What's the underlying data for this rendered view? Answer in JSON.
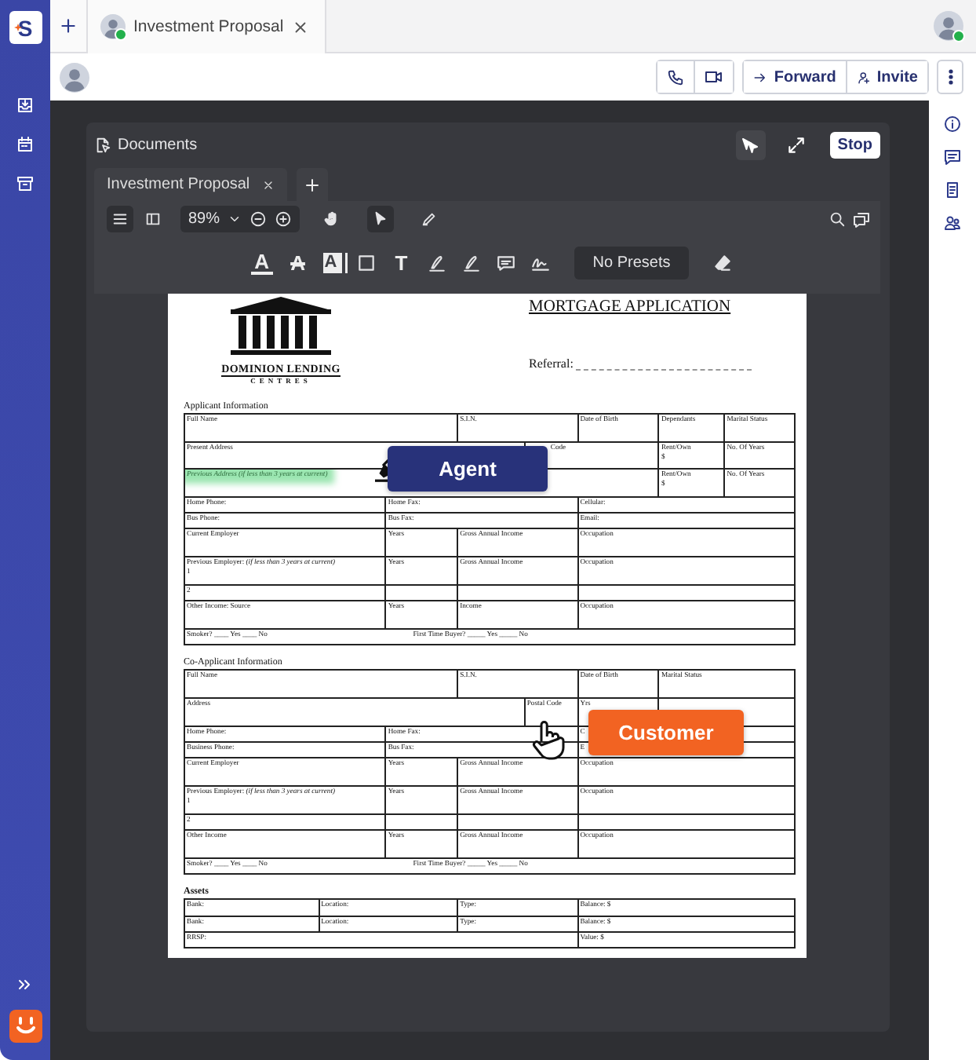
{
  "sidebar": {
    "logo": "S"
  },
  "tab_bar": {
    "tabs": [
      {
        "label": "Investment Proposal",
        "selected": true,
        "online": true
      }
    ],
    "user_online": true
  },
  "actions": [
    {
      "kind": "forward",
      "label": "Forward"
    },
    {
      "kind": "invite",
      "label": "Invite"
    }
  ],
  "documents": {
    "title": "Documents",
    "stop": "Stop",
    "viewer_tabs": [
      {
        "label": "Investment Proposal",
        "selected": true
      }
    ],
    "view_tools": [
      {
        "kind": "menu",
        "selected": true
      },
      {
        "kind": "panel",
        "selected": false
      }
    ],
    "zoom": "89%",
    "nav_tools": [
      {
        "kind": "hand",
        "selected": false
      },
      {
        "kind": "cursor",
        "selected": true
      },
      {
        "kind": "pen",
        "selected": false
      }
    ],
    "annotation_tools": [
      {
        "kind": "underline",
        "glyph": "A"
      },
      {
        "kind": "strike",
        "glyph": "A"
      },
      {
        "kind": "boxed",
        "glyph": "A"
      },
      {
        "kind": "square"
      },
      {
        "kind": "type",
        "glyph": "T"
      },
      {
        "kind": "pen"
      },
      {
        "kind": "pen"
      },
      {
        "kind": "comment"
      },
      {
        "kind": "signature"
      }
    ],
    "presets": "No Presets"
  },
  "form": {
    "logo_name": "DOMINION LENDING",
    "logo_sub": "CENTRES",
    "title": "MORTGAGE APPLICATION",
    "referral": "Referral:",
    "sections": [
      {
        "heading": "Applicant Information",
        "rows": [
          {
            "kind": "ident5",
            "cells": [
              "Full Name",
              "S.I.N.",
              "Date of Birth",
              "Dependants",
              "Marital Status"
            ]
          },
          {
            "kind": "addr5",
            "cells": [
              "Present Address",
              "Code",
              null,
              [
                "Rent/Own",
                "$"
              ],
              "No. Of Years"
            ]
          },
          {
            "kind": "prev5",
            "cells": [
              {
                "text": "Previous Address (if less than 3 years at current)",
                "highlighted": true
              },
              null,
              null,
              [
                "Rent/Own",
                "$"
              ],
              "No. Of Years"
            ]
          },
          {
            "kind": "phone3",
            "cells": [
              "Home Phone:",
              "Home Fax:",
              "Cellular:"
            ]
          },
          {
            "kind": "phone3",
            "cells": [
              "Bus Phone:",
              "Bus Fax:",
              "Email:"
            ]
          },
          {
            "kind": "emp4",
            "cells": [
              "Current Employer",
              "Years",
              "Gross Annual Income",
              "Occupation"
            ]
          },
          {
            "kind": "emp4",
            "cells": [
              [
                "Previous Employer: *(if less than 3 years at current)*",
                "1"
              ],
              "Years",
              "Gross Annual Income",
              "Occupation"
            ]
          },
          {
            "kind": "emp4s",
            "cells": [
              "2",
              null,
              null,
              null
            ]
          },
          {
            "kind": "emp4",
            "cells": [
              "Other Income: Source",
              "Years",
              "Income",
              "Occupation"
            ]
          },
          {
            "kind": "note2",
            "cells": [
              "Smoker?  ____ Yes  ____ No",
              "First Time Buyer?  _____ Yes  _____ No"
            ]
          }
        ]
      },
      {
        "heading": "Co-Applicant Information",
        "rows": [
          {
            "kind": "ident4",
            "cells": [
              "Full Name",
              "S.I.N.",
              "Date of Birth",
              "Marital Status"
            ]
          },
          {
            "kind": "addr4c",
            "cells": [
              "Address",
              "Postal Code",
              "Yrs",
              null
            ]
          },
          {
            "kind": "phone3",
            "cells": [
              "Home Phone:",
              "Home Fax:",
              "C"
            ]
          },
          {
            "kind": "phone3",
            "cells": [
              "Business Phone:",
              "Bus Fax:",
              "E"
            ]
          },
          {
            "kind": "emp4",
            "cells": [
              "Current Employer",
              "Years",
              "Gross Annual Income",
              "Occupation"
            ]
          },
          {
            "kind": "emp4",
            "cells": [
              [
                "Previous Employer: *(if less than 3 years at current)*",
                "1"
              ],
              "Years",
              "Gross Annual Income",
              "Occupation"
            ]
          },
          {
            "kind": "emp4s",
            "cells": [
              "2",
              null,
              null,
              null
            ]
          },
          {
            "kind": "emp4",
            "cells": [
              "Other Income",
              "Years",
              "Gross Annual Income",
              "Occupation"
            ]
          },
          {
            "kind": "note2",
            "cells": [
              "Smoker?  ____ Yes  ____ No",
              "First Time Buyer?  _____ Yes  _____ No"
            ]
          }
        ]
      },
      {
        "heading": "Assets",
        "rows": [
          {
            "kind": "asset4",
            "cells": [
              "Bank:",
              "Location:",
              "Type:",
              "Balance: $"
            ]
          },
          {
            "kind": "asset4",
            "cells": [
              "Bank:",
              "Location:",
              "Type:",
              "Balance: $"
            ]
          },
          {
            "kind": "asset2",
            "cells": [
              "RRSP:",
              null,
              null,
              "Value: $"
            ]
          }
        ]
      }
    ]
  },
  "cursors": [
    {
      "kind": "agent",
      "label": "Agent"
    },
    {
      "kind": "customer",
      "label": "Customer"
    }
  ]
}
